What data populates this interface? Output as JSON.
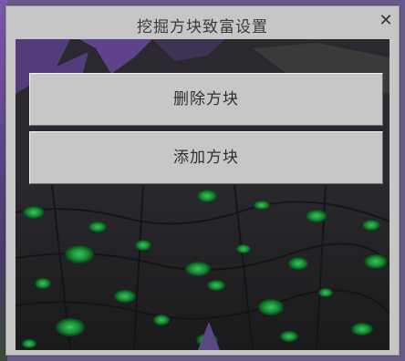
{
  "dialog": {
    "title": "挖掘方块致富设置",
    "close_label": "✕"
  },
  "buttons": {
    "delete_label": "删除方块",
    "add_label": "添加方块"
  }
}
